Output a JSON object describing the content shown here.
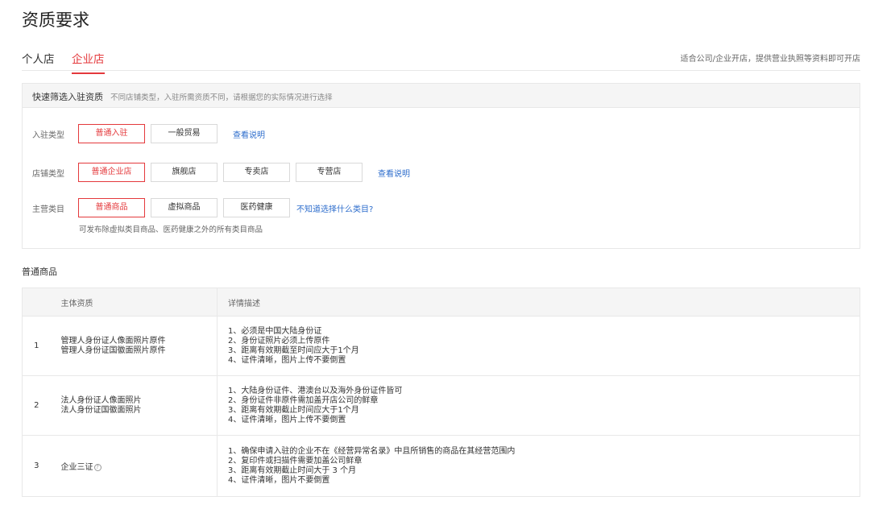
{
  "page_title": "资质要求",
  "tabs": [
    {
      "label": "个人店",
      "active": false
    },
    {
      "label": "企业店",
      "active": true
    }
  ],
  "tabs_hint": "适合公司/企业开店，提供营业执照等资料即可开店",
  "filter": {
    "title": "快速筛选入驻资质",
    "desc": "不同店铺类型，入驻所需资质不同，请根据您的实际情况进行选择",
    "rows": [
      {
        "label": "入驻类型",
        "options": [
          "普通入驻",
          "一般贸易"
        ],
        "selected": "普通入驻",
        "link": "查看说明"
      },
      {
        "label": "店铺类型",
        "options": [
          "普通企业店",
          "旗舰店",
          "专卖店",
          "专营店"
        ],
        "selected": "普通企业店",
        "link": "查看说明"
      },
      {
        "label": "主营类目",
        "options": [
          "普通商品",
          "虚拟商品",
          "医药健康"
        ],
        "selected": "普通商品",
        "link": "不知道选择什么类目?"
      }
    ],
    "note": "可发布除虚拟类目商品、医药健康之外的所有类目商品"
  },
  "section_title": "普通商品",
  "table": {
    "headers": [
      "主体资质",
      "详情描述"
    ],
    "rows": [
      {
        "index": "1",
        "subject": [
          "管理人身份证人像面照片原件",
          "管理人身份证国徽面照片原件"
        ],
        "details": [
          "1、必须是中国大陆身份证",
          "2、身份证照片必须上传原件",
          "3、距离有效期截至时间应大于1个月",
          "4、证件清晰，图片上传不要倒置"
        ]
      },
      {
        "index": "2",
        "subject": [
          "法人身份证人像面照片",
          "法人身份证国徽面照片"
        ],
        "details": [
          "1、大陆身份证件、港澳台以及海外身份证件皆可",
          "2、身份证件非原件需加盖开店公司的鲜章",
          "3、距离有效期截止时间应大于1个月",
          "4、证件清晰，图片上传不要倒置"
        ]
      },
      {
        "index": "3",
        "subject": [
          "企业三证"
        ],
        "subject_icon": "help-circle-icon",
        "details": [
          "1、确保申请入驻的企业不在《经营异常名录》中且所销售的商品在其经营范围内",
          "2、复印件或扫描件需要加盖公司鲜章",
          "3、距离有效期截止时间大于 3 个月",
          "4、证件清晰，图片不要倒置"
        ]
      }
    ]
  },
  "colors": {
    "accent": "#e4393c",
    "link": "#2d6dcc"
  }
}
